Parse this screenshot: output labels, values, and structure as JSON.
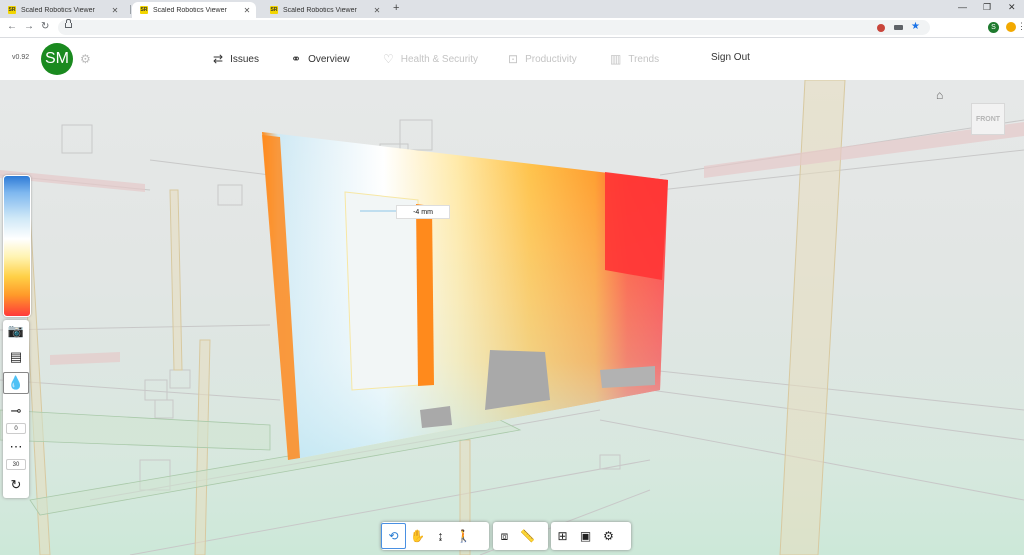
{
  "browser": {
    "tabs": [
      {
        "title": "Scaled Robotics Viewer",
        "favicon": "SR"
      },
      {
        "title": "Scaled Robotics Viewer",
        "favicon": "SR"
      },
      {
        "title": "Scaled Robotics Viewer",
        "favicon": "SR"
      }
    ],
    "new_tab": "+",
    "window_controls": [
      "—",
      "❐",
      "✕"
    ],
    "profile_initial": "S"
  },
  "app": {
    "version": "v0.92",
    "avatar_initials": "SM",
    "nav": [
      {
        "label": "Issues",
        "icon": "issues-icon",
        "state": "enabled"
      },
      {
        "label": "Overview",
        "icon": "binoculars-icon",
        "state": "enabled"
      },
      {
        "label": "Health & Security",
        "icon": "heart-icon",
        "state": "disabled"
      },
      {
        "label": "Productivity",
        "icon": "productivity-icon",
        "state": "disabled"
      },
      {
        "label": "Trends",
        "icon": "trends-icon",
        "state": "disabled"
      },
      {
        "label": "Sign Out",
        "icon": "",
        "state": "enabled"
      }
    ]
  },
  "viewer": {
    "measure_label": "-4 mm",
    "view_cube_label": "FRONT",
    "left_tools": {
      "slider_value_1": "0",
      "slider_value_2": "30"
    },
    "colors": {
      "deviation_high": "#ff3a3a",
      "deviation_mid": "#ffd046",
      "deviation_zero": "#ffffff",
      "deviation_low": "#2e7bd6"
    }
  }
}
